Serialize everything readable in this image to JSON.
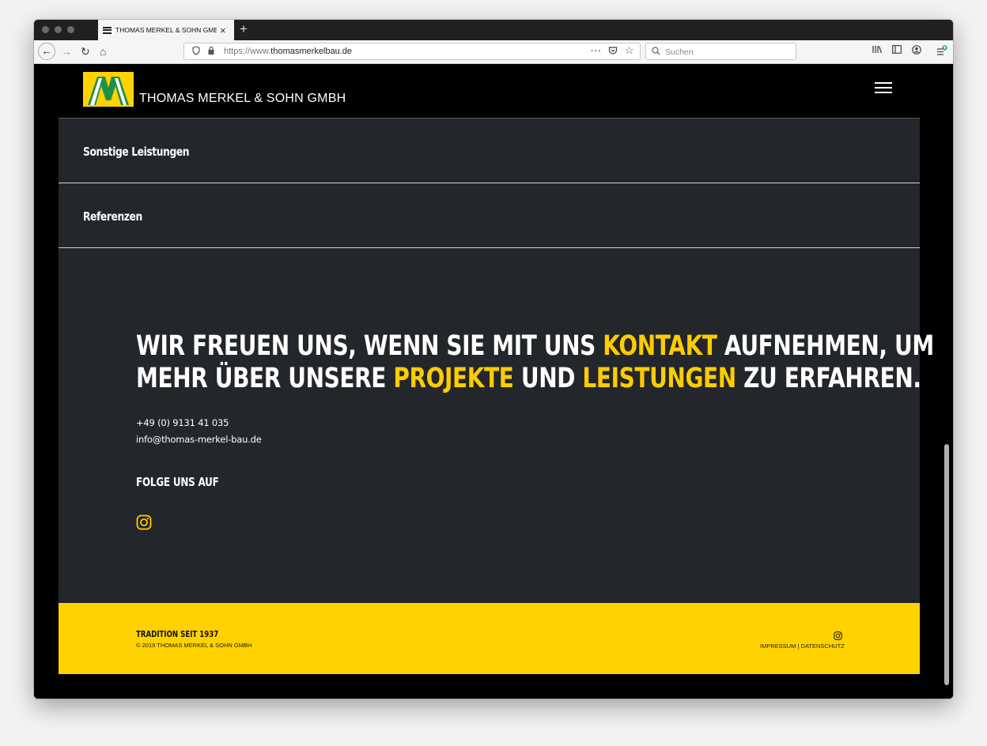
{
  "browser": {
    "tab_title": "THOMAS MERKEL & SOHN GMBH",
    "new_tab": "+",
    "url_prefix": "https://www.",
    "url_domain": "thomasmerkelbau.de",
    "search_placeholder": "Suchen"
  },
  "site": {
    "brand": "THOMAS MERKEL & SOHN GMBH",
    "logo_letter": "M"
  },
  "menu": {
    "items": [
      {
        "label": "Sonstige Leistungen"
      },
      {
        "label": "Referenzen"
      }
    ]
  },
  "contact": {
    "headline_line1_a": "WIR FREUEN UNS, WENN SIE MIT UNS ",
    "headline_line1_hl": "KONTAKT",
    "headline_line1_b": " AUFNEHMEN, UM",
    "headline_line2_a": "MEHR ÜBER UNSERE ",
    "headline_line2_hl1": "PROJEKTE",
    "headline_line2_b": " UND ",
    "headline_line2_hl2": "LEISTUNGEN",
    "headline_line2_c": " ZU ERFAHREN.",
    "phone": "+49 (0) 9131 41 035",
    "email": "info@thomas-merkel-bau.de",
    "follow_label": "FOLGE UNS AUF"
  },
  "footer": {
    "tagline": "TRADITION SEIT 1937",
    "copyright": "© 2019 THOMAS MERKEL & SOHN GMBH",
    "links": "IMPRESSUM | DATENSCHUTZ"
  },
  "colors": {
    "accent": "#ffcc00",
    "footer_bg": "#ffd200",
    "main_bg": "#23262b"
  }
}
